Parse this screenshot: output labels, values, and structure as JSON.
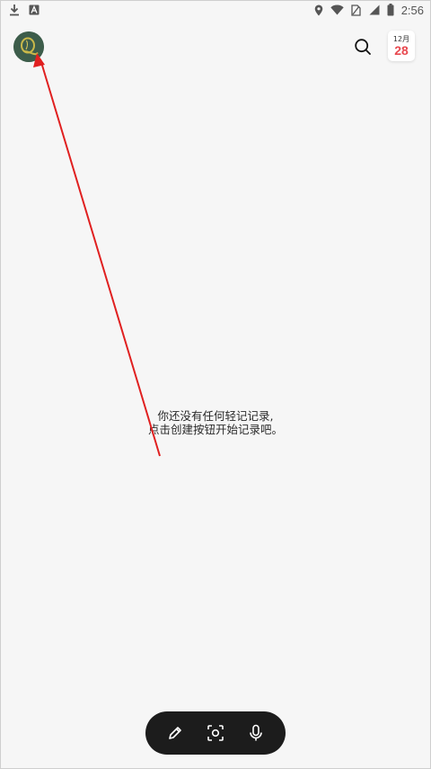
{
  "status_bar": {
    "time": "2:56",
    "icons": [
      "download-icon",
      "a-notification-icon",
      "location-icon",
      "wifi-icon",
      "sim-off-icon",
      "signal-icon",
      "battery-icon"
    ]
  },
  "header": {
    "avatar_icon": "q-logo-avatar",
    "search_icon": "search-icon",
    "calendar": {
      "month": "12月",
      "day": "28"
    }
  },
  "empty_state": {
    "line1": "你还没有任何轻记记录,",
    "line2": "点击创建按钮开始记录吧。"
  },
  "toolbar": {
    "buttons": [
      {
        "icon": "pencil-icon"
      },
      {
        "icon": "scan-icon"
      },
      {
        "icon": "microphone-icon"
      }
    ]
  },
  "colors": {
    "background": "#f6f6f6",
    "accent_red": "#e8484f",
    "toolbar": "#1c1c1c",
    "annotation_arrow": "#e02020"
  }
}
